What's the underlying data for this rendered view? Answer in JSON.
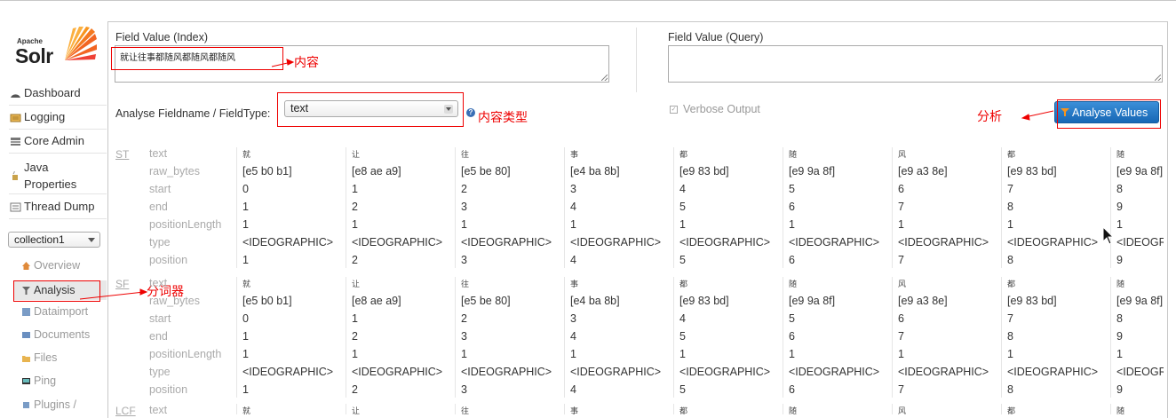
{
  "sidebar": {
    "logo": {
      "apache": "Apache",
      "solr": "Solr"
    },
    "nav": [
      {
        "label": "Dashboard",
        "icon": "dashboard-icon"
      },
      {
        "label": "Logging",
        "icon": "logging-icon"
      },
      {
        "label": "Core Admin",
        "icon": "core-admin-icon"
      },
      {
        "label": "Java Properties",
        "icon": "java-icon"
      },
      {
        "label": "Thread Dump",
        "icon": "thread-dump-icon"
      }
    ],
    "core_selector": "collection1",
    "core_menu": [
      {
        "label": "Overview",
        "icon": "home-icon"
      },
      {
        "label": "Analysis",
        "icon": "filter-icon"
      },
      {
        "label": "Dataimport",
        "icon": "dataimport-icon"
      },
      {
        "label": "Documents",
        "icon": "documents-icon"
      },
      {
        "label": "Files",
        "icon": "folder-icon"
      },
      {
        "label": "Ping",
        "icon": "ping-icon"
      },
      {
        "label": "Plugins /",
        "icon": "plugins-icon"
      }
    ]
  },
  "form": {
    "index_label": "Field Value (Index)",
    "index_value": "就让往事都随风都随风都随风",
    "query_label": "Field Value (Query)",
    "query_value": "",
    "fieldtype_label": "Analyse Fieldname / FieldType:",
    "fieldtype_value": "text",
    "help_icon": "?",
    "verbose_label": "Verbose Output",
    "verbose_checked": true,
    "analyse_button": "Analyse Values"
  },
  "annotations": {
    "content": "内容",
    "content_type": "内容类型",
    "analyze": "分析",
    "tokenizer": "分词器",
    "color": "#e00000"
  },
  "analysis": {
    "row_labels": [
      "text",
      "raw_bytes",
      "start",
      "end",
      "positionLength",
      "type",
      "position"
    ],
    "stages": [
      {
        "name": "ST",
        "tokens": [
          {
            "text": "就",
            "raw_bytes": "[e5 b0 b1]",
            "start": "0",
            "end": "1",
            "positionLength": "1",
            "type": "<IDEOGRAPHIC>",
            "position": "1"
          },
          {
            "text": "让",
            "raw_bytes": "[e8 ae a9]",
            "start": "1",
            "end": "2",
            "positionLength": "1",
            "type": "<IDEOGRAPHIC>",
            "position": "2"
          },
          {
            "text": "往",
            "raw_bytes": "[e5 be 80]",
            "start": "2",
            "end": "3",
            "positionLength": "1",
            "type": "<IDEOGRAPHIC>",
            "position": "3"
          },
          {
            "text": "事",
            "raw_bytes": "[e4 ba 8b]",
            "start": "3",
            "end": "4",
            "positionLength": "1",
            "type": "<IDEOGRAPHIC>",
            "position": "4"
          },
          {
            "text": "都",
            "raw_bytes": "[e9 83 bd]",
            "start": "4",
            "end": "5",
            "positionLength": "1",
            "type": "<IDEOGRAPHIC>",
            "position": "5"
          },
          {
            "text": "随",
            "raw_bytes": "[e9 9a 8f]",
            "start": "5",
            "end": "6",
            "positionLength": "1",
            "type": "<IDEOGRAPHIC>",
            "position": "6"
          },
          {
            "text": "风",
            "raw_bytes": "[e9 a3 8e]",
            "start": "6",
            "end": "7",
            "positionLength": "1",
            "type": "<IDEOGRAPHIC>",
            "position": "7"
          },
          {
            "text": "都",
            "raw_bytes": "[e9 83 bd]",
            "start": "7",
            "end": "8",
            "positionLength": "1",
            "type": "<IDEOGRAPHIC>",
            "position": "8"
          },
          {
            "text": "随",
            "raw_bytes": "[e9 9a 8f]",
            "start": "8",
            "end": "9",
            "positionLength": "1",
            "type": "<IDEOGRAPHIC>",
            "position": "9"
          }
        ]
      },
      {
        "name": "SF",
        "tokens": [
          {
            "text": "就",
            "raw_bytes": "[e5 b0 b1]",
            "start": "0",
            "end": "1",
            "positionLength": "1",
            "type": "<IDEOGRAPHIC>",
            "position": "1"
          },
          {
            "text": "让",
            "raw_bytes": "[e8 ae a9]",
            "start": "1",
            "end": "2",
            "positionLength": "1",
            "type": "<IDEOGRAPHIC>",
            "position": "2"
          },
          {
            "text": "往",
            "raw_bytes": "[e5 be 80]",
            "start": "2",
            "end": "3",
            "positionLength": "1",
            "type": "<IDEOGRAPHIC>",
            "position": "3"
          },
          {
            "text": "事",
            "raw_bytes": "[e4 ba 8b]",
            "start": "3",
            "end": "4",
            "positionLength": "1",
            "type": "<IDEOGRAPHIC>",
            "position": "4"
          },
          {
            "text": "都",
            "raw_bytes": "[e9 83 bd]",
            "start": "4",
            "end": "5",
            "positionLength": "1",
            "type": "<IDEOGRAPHIC>",
            "position": "5"
          },
          {
            "text": "随",
            "raw_bytes": "[e9 9a 8f]",
            "start": "5",
            "end": "6",
            "positionLength": "1",
            "type": "<IDEOGRAPHIC>",
            "position": "6"
          },
          {
            "text": "风",
            "raw_bytes": "[e9 a3 8e]",
            "start": "6",
            "end": "7",
            "positionLength": "1",
            "type": "<IDEOGRAPHIC>",
            "position": "7"
          },
          {
            "text": "都",
            "raw_bytes": "[e9 83 bd]",
            "start": "7",
            "end": "8",
            "positionLength": "1",
            "type": "<IDEOGRAPHIC>",
            "position": "8"
          },
          {
            "text": "随",
            "raw_bytes": "[e9 9a 8f]",
            "start": "8",
            "end": "9",
            "positionLength": "1",
            "type": "<IDEOGRAPHIC>",
            "position": "9"
          }
        ]
      },
      {
        "name": "LCF",
        "tokens": [
          {
            "text": "就"
          },
          {
            "text": "让"
          },
          {
            "text": "往"
          },
          {
            "text": "事"
          },
          {
            "text": "都"
          },
          {
            "text": "随"
          },
          {
            "text": "风"
          },
          {
            "text": "都"
          },
          {
            "text": "随"
          }
        ]
      }
    ]
  },
  "colors": {
    "accent": "#1767b5",
    "muted": "#aaaaaa",
    "annotation": "#e00000"
  }
}
